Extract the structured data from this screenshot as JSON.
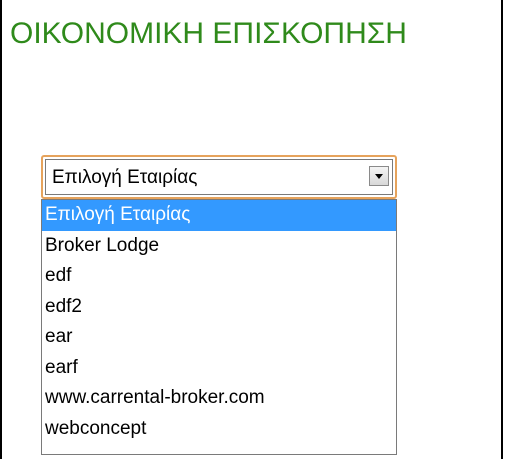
{
  "header": {
    "title": "ΟΙΚΟΝΟΜΙΚΗ ΕΠΙΣΚΟΠΗΣΗ"
  },
  "company_select": {
    "selected_value": "Επιλογή Εταιρίας",
    "options": [
      "Επιλογή Εταιρίας",
      "Broker Lodge",
      "edf",
      "edf2",
      "ear",
      "earf",
      "www.carrental-broker.com",
      "webconcept"
    ],
    "highlighted_index": 0
  },
  "colors": {
    "title": "#2f8a1b",
    "highlight": "#3399ff",
    "focus_border": "#e6a35c"
  },
  "icons": {
    "dropdown_arrow": "chevron-down-icon"
  }
}
